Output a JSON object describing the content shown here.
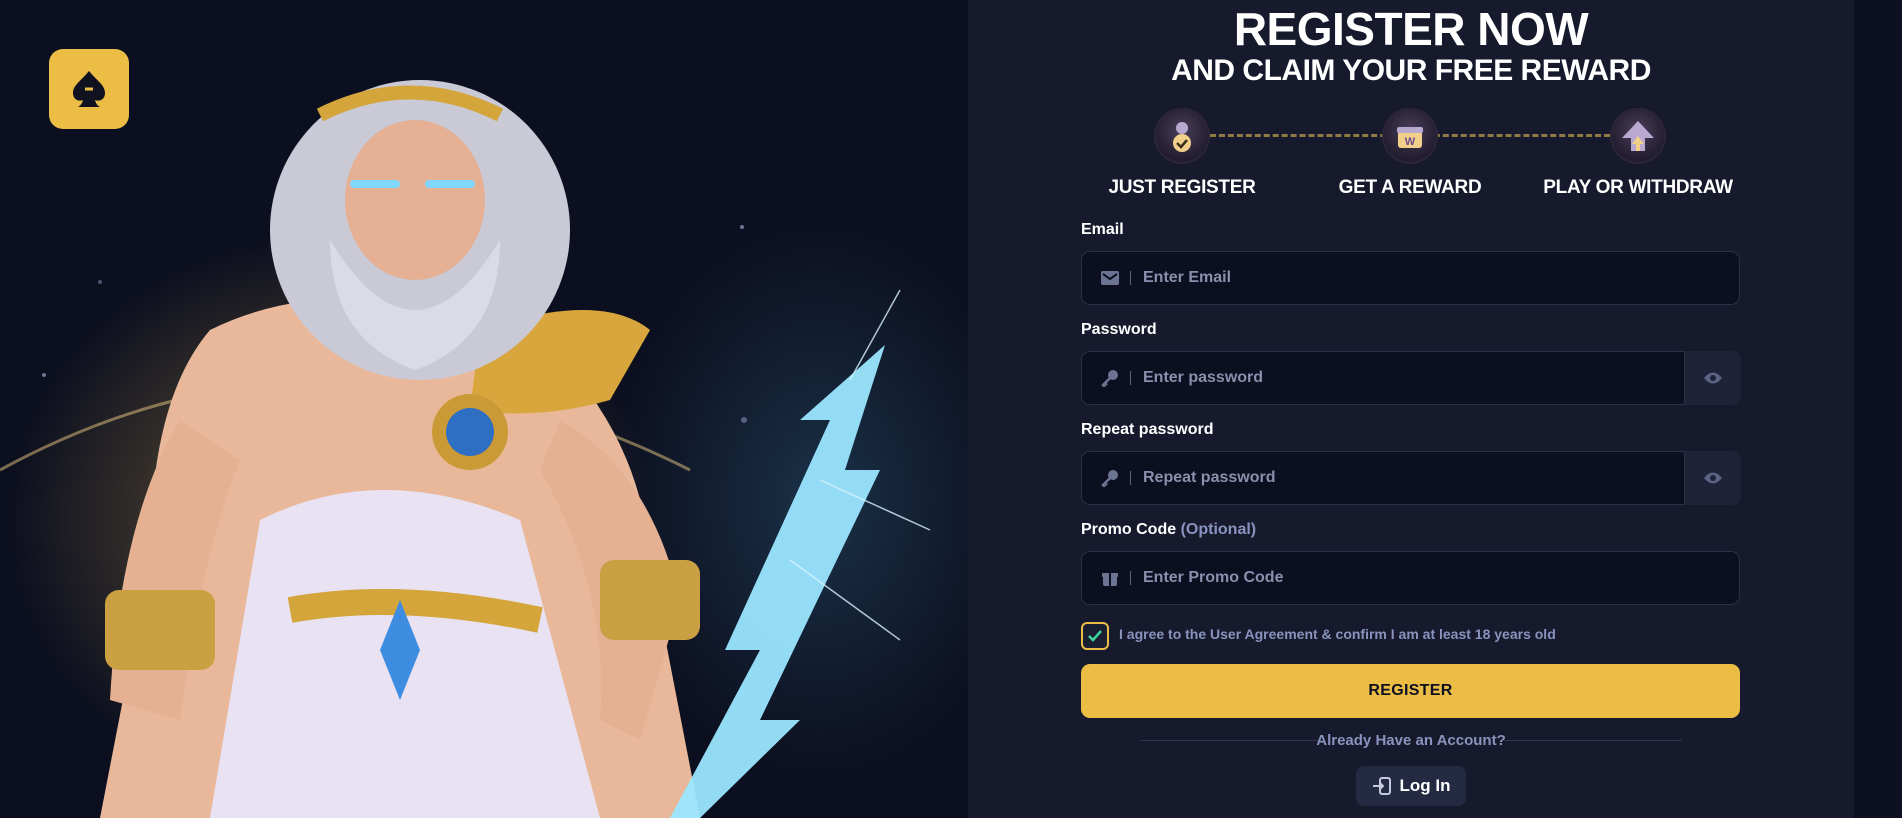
{
  "brand": {
    "logo_icon": "spade-icon",
    "accent": "#ebbd45"
  },
  "header": {
    "title": "REGISTER NOW",
    "subtitle": "AND CLAIM YOUR FREE REWARD"
  },
  "steps": [
    {
      "label": "JUST REGISTER",
      "icon": "user-check-icon"
    },
    {
      "label": "GET A REWARD",
      "icon": "gift-box-icon"
    },
    {
      "label": "PLAY OR WITHDRAW",
      "icon": "arrow-up-icon"
    }
  ],
  "form": {
    "email": {
      "label": "Email",
      "placeholder": "Enter Email",
      "icon": "envelope-icon"
    },
    "password": {
      "label": "Password",
      "placeholder": "Enter password",
      "icon": "key-icon",
      "toggle_icon": "eye-icon"
    },
    "repeat_password": {
      "label": "Repeat password",
      "placeholder": "Repeat password",
      "icon": "key-icon",
      "toggle_icon": "eye-icon"
    },
    "promo": {
      "label": "Promo Code",
      "optional": "(Optional)",
      "placeholder": "Enter Promo Code",
      "icon": "gift-icon"
    },
    "agreement": {
      "text": "I agree to the User Agreement & confirm I am at least 18 years old",
      "checked": true
    },
    "register_label": "REGISTER"
  },
  "footer": {
    "already": "Already Have an Account?",
    "login_label": "Log In",
    "login_icon": "login-icon"
  }
}
